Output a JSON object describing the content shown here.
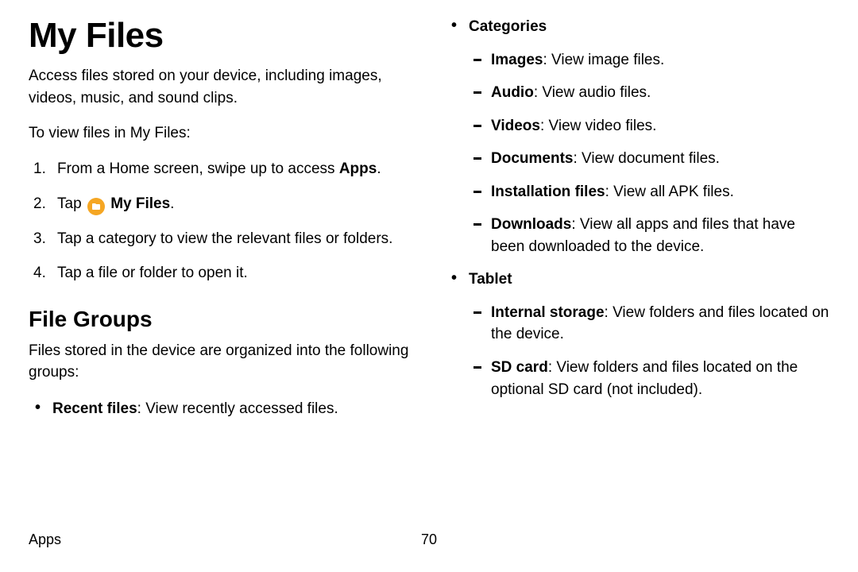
{
  "title": "My Files",
  "intro": "Access files stored on your device, including images, videos, music, and sound clips.",
  "lead": "To view files in My Files:",
  "steps": {
    "s1_a": "From a Home screen, swipe up to access ",
    "s1_b": "Apps",
    "s1_c": ".",
    "s2_a": "Tap ",
    "s2_b": " My Files",
    "s2_c": ".",
    "s3": "Tap a category to view the relevant files or folders.",
    "s4": "Tap a file or folder to open it."
  },
  "h2": "File Groups",
  "sub": "Files stored in the device are organized into the following groups:",
  "recent_b": "Recent files",
  "recent_t": ": View recently accessed files.",
  "cat_label": "Categories",
  "cats": {
    "img_b": "Images",
    "img_t": ": View image files.",
    "aud_b": "Audio",
    "aud_t": ": View audio files.",
    "vid_b": "Videos",
    "vid_t": ": View video files.",
    "doc_b": "Documents",
    "doc_t": ": View document files.",
    "apk_b": "Installation files",
    "apk_t": ": View all APK files.",
    "dl_b": "Downloads",
    "dl_t": ": View all apps and files that have been downloaded to the device."
  },
  "tab_label": "Tablet",
  "tab": {
    "int_b": "Internal storage",
    "int_t": ": View folders and files located on the device.",
    "sd_b": "SD card",
    "sd_t": ": View folders and files located on the optional SD card (not included)."
  },
  "footer_section": "Apps",
  "footer_page": "70"
}
